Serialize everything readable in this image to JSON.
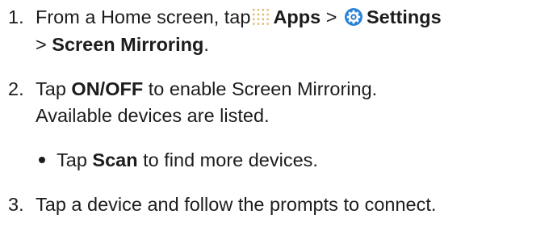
{
  "steps": [
    {
      "number": "1.",
      "line1_a": "From a Home screen, tap",
      "apps_label": "Apps",
      "sep1": ">",
      "settings_label": "Settings",
      "line2_sep": ">",
      "screen_mirroring_label": "Screen Mirroring",
      "line2_end": "."
    },
    {
      "number": "2.",
      "line1_a": "Tap",
      "onoff_label": "ON/OFF",
      "line1_b": "to enable Screen Mirroring.",
      "line2": "Available devices are listed."
    },
    {
      "number": "3.",
      "line1": "Tap a device and follow the prompts to connect."
    }
  ],
  "bullet": {
    "prefix": "Tap",
    "scan_label": "Scan",
    "suffix": "to find more devices."
  },
  "icons": {
    "apps": "apps-grid-icon",
    "settings": "settings-gear-icon"
  },
  "colors": {
    "text": "#1c1c1c",
    "apps_dot": "#e0b96a",
    "settings_blue": "#1f76c8"
  }
}
